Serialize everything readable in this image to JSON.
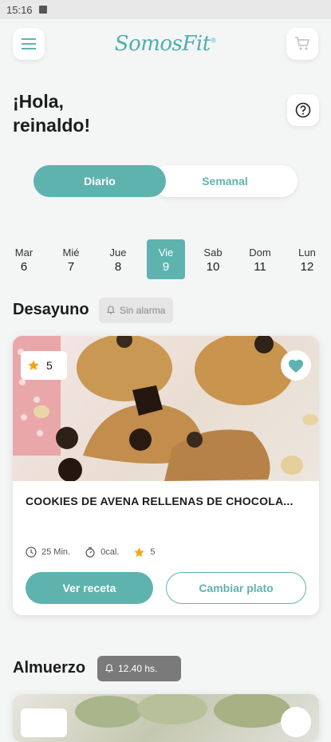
{
  "status_bar": {
    "time": "15:16"
  },
  "header": {
    "logo_text": "SomosFit",
    "logo_mark": "®"
  },
  "greeting": {
    "line1": "¡Hola,",
    "line2": "reinaldo!"
  },
  "toggle": {
    "daily": "Diario",
    "weekly": "Semanal"
  },
  "days": [
    {
      "name": "Mar",
      "num": "6"
    },
    {
      "name": "Mié",
      "num": "7"
    },
    {
      "name": "Jue",
      "num": "8"
    },
    {
      "name": "Vie",
      "num": "9",
      "selected": true
    },
    {
      "name": "Sab",
      "num": "10"
    },
    {
      "name": "Dom",
      "num": "11"
    },
    {
      "name": "Lun",
      "num": "12"
    }
  ],
  "breakfast": {
    "title": "Desayuno",
    "alarm": "Sin alarma",
    "card": {
      "rating": "5",
      "name": "COOKIES DE AVENA RELLENAS DE CHOCOLA...",
      "time": "25 Min.",
      "calories": "0cal.",
      "stars": "5",
      "view_label": "Ver receta",
      "change_label": "Cambiar plato"
    }
  },
  "lunch": {
    "title": "Almuerzo",
    "alarm": "12.40 hs.",
    "card": {
      "rating": ""
    }
  },
  "colors": {
    "accent": "#5fb3ae",
    "star": "#f2a516"
  }
}
